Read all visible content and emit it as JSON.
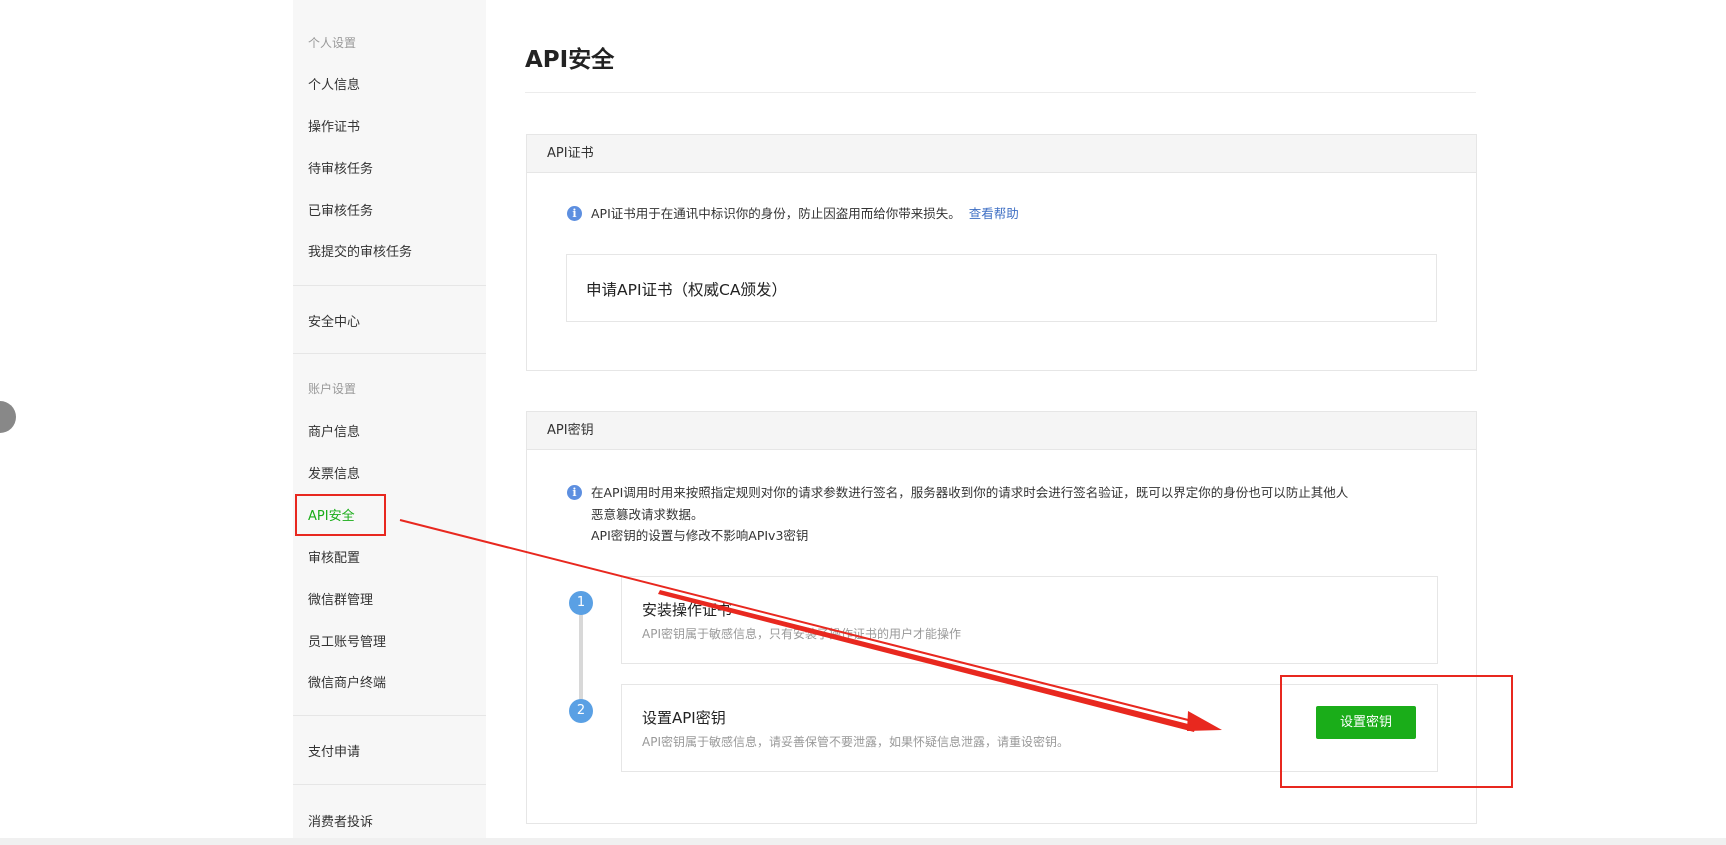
{
  "sidebar": {
    "groups": [
      {
        "label": "个人设置",
        "items": [
          "个人信息",
          "操作证书",
          "待审核任务",
          "已审核任务",
          "我提交的审核任务"
        ]
      },
      {
        "label": "",
        "items": [
          "安全中心"
        ]
      },
      {
        "label": "账户设置",
        "items": [
          "商户信息",
          "发票信息",
          "API安全",
          "审核配置",
          "微信群管理",
          "员工账号管理",
          "微信商户终端"
        ]
      },
      {
        "label": "",
        "items": [
          "支付申请"
        ]
      },
      {
        "label": "",
        "items": [
          "消费者投诉"
        ]
      }
    ],
    "active_item": "API安全"
  },
  "main": {
    "title": "API安全",
    "cert_panel": {
      "header": "API证书",
      "info": "API证书用于在通讯中标识你的身份，防止因盗用而给你带来损失。",
      "help_link": "查看帮助",
      "apply_label": "申请API证书（权威CA颁发）"
    },
    "key_panel": {
      "header": "API密钥",
      "info_line1": "在API调用时用来按照指定规则对你的请求参数进行签名，服务器收到你的请求时会进行签名验证，既可以界定你的身份也可以防止其他人",
      "info_line2": "恶意篡改请求数据。",
      "info_line3": "API密钥的设置与修改不影响APIv3密钥",
      "steps": [
        {
          "num": "1",
          "title": "安装操作证书",
          "desc": "API密钥属于敏感信息，只有安装了操作证书的用户才能操作"
        },
        {
          "num": "2",
          "title": "设置API密钥",
          "desc": "API密钥属于敏感信息，请妥善保管不要泄露，如果怀疑信息泄露，请重设密钥。"
        }
      ],
      "set_key_button": "设置密钥"
    }
  },
  "icons": {
    "info": "info-icon"
  },
  "colors": {
    "accent_green": "#1aad19",
    "annotation_red": "#e8281f",
    "info_blue": "#5d8fe0",
    "link_blue": "#3f6fc4"
  }
}
